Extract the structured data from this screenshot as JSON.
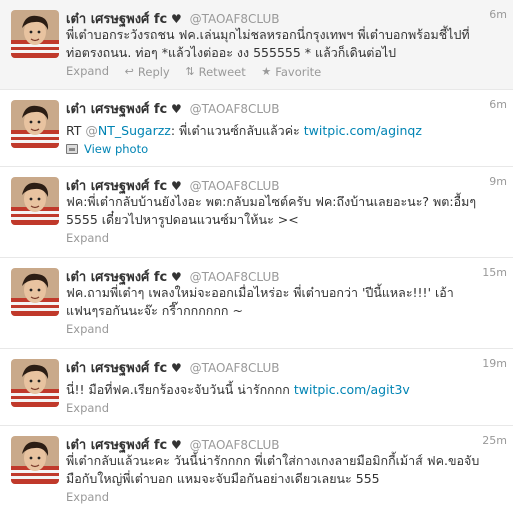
{
  "account": {
    "fullname": "เต๋า เศรษฐพงศ์ fc",
    "heart": "♥",
    "username": "@TAOAF8CLUB"
  },
  "tweets": [
    {
      "time": "6m",
      "lines": [
        "พี่เต๋าบอกระวังรถชน ฟค.เล่นมุกไม่ชลหรอกนี่กรุงเทพฯ พี่เต๋าบอกพร้อมชี้ไปที่",
        "ท่อตรงถนน. ท่อๆ *แล้วไงต่ออะ งง 555555 * แล้วก็เดินต่อไป"
      ],
      "actions": {
        "expand": "Expand",
        "reply": "Reply",
        "retweet": "Retweet",
        "favorite": "Favorite"
      }
    },
    {
      "time": "6m",
      "rt": "RT",
      "mention_at": "@",
      "mention_name": "NT_Sugarzz",
      "text": ": พี่เต๋าแวนซ์กลับแล้วค่ะ",
      "link": "twitpic.com/aginqz",
      "view_photo": "View photo"
    },
    {
      "time": "9m",
      "lines": [
        "ฟค:พี่เต๋ากลับบ้านยังไงอะ พต:กลับมอไซต์ครับ ฟค:ถึงบ้านเลยอะนะ? พต:อื้มๆ",
        "5555 เดี๋ยวไปหารูปดอนแวนซ์มาให้นะ ><"
      ],
      "expand": "Expand"
    },
    {
      "time": "15m",
      "lines": [
        "ฟค.ถามพี่เต๋าๆ เพลงใหม่จะออกเมื่อไหร่อะ พี่เต๋าบอกว่า 'ปีนี้แหละ!!!' เอ้า",
        "แฟนๆรอกันนะจ๊ะ กรี๊ากกกกกก ~"
      ],
      "expand": "Expand"
    },
    {
      "time": "19m",
      "text": "นี่!! มือที่ฟค.เรียกร้องจะจับวันนี้ น่ารักกกก",
      "link": "twitpic.com/agit3v",
      "expand": "Expand"
    },
    {
      "time": "25m",
      "lines": [
        "พี่เต๋ากลับแล้วนะคะ วันนี้น่ารักกกก พี่เต๋าใส่กางเกงลายมือมิกกี้เม้าส์ ฟค.ขอจับ",
        "มือกับใหญ่พี่เต๋าบอก แหมจะจับมือกันอย่างเดียวเลยนะ 555"
      ],
      "expand": "Expand"
    }
  ],
  "colors": {
    "link": "#0084b4",
    "meta": "#999999",
    "text": "#333333",
    "highlight_bg": "#f5f5f5"
  },
  "icons": [
    "reply-icon",
    "retweet-icon",
    "favorite-star-icon",
    "photo-icon",
    "avatar"
  ]
}
